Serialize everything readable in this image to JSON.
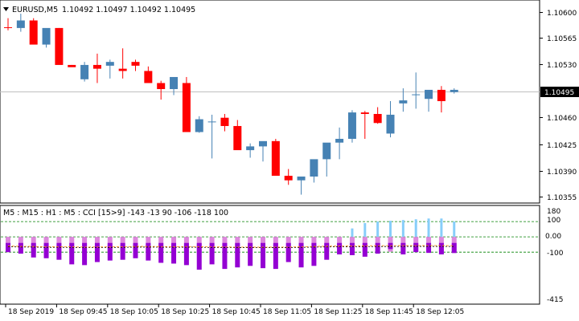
{
  "header": {
    "symbol_timeframe": "EURUSD,M5",
    "ohlc": "1.10492 1.10497 1.10492 1.10495",
    "dropdown_icon": "triangle-down-icon"
  },
  "indicator": {
    "label": "M5 : M15 : H1 : M5 : CCI [15>9] -143 -13 90 -106 -118 100"
  },
  "price_scale": {
    "ticks": [
      "1.10600",
      "1.10565",
      "1.10530",
      "1.10460",
      "1.10425",
      "1.10390",
      "1.10355"
    ],
    "current_price": "1.10495"
  },
  "cci_scale": {
    "ticks": [
      "180",
      "100",
      "0.00",
      "-100",
      "-415"
    ]
  },
  "time_axis": {
    "labels": [
      "18 Sep 2019",
      "18 Sep 09:45",
      "18 Sep 10:05",
      "18 Sep 10:25",
      "18 Sep 10:45",
      "18 Sep 11:05",
      "18 Sep 11:25",
      "18 Sep 11:45",
      "18 Sep 12:05"
    ]
  },
  "colors": {
    "bull": "#4682B4",
    "bear": "#FF0000",
    "hist_light": "#DD88DD",
    "hist_dark": "#9400D3",
    "hist_pos": "#87CEFA",
    "level_line": "#008000",
    "grid_price_line": "#C0C0C0"
  },
  "chart_data": [
    {
      "type": "candlestick",
      "x": [
        "09:25",
        "09:30",
        "09:35",
        "09:40",
        "09:45",
        "09:50",
        "09:55",
        "10:00",
        "10:05",
        "10:10",
        "10:15",
        "10:20",
        "10:25",
        "10:30",
        "10:35",
        "10:40",
        "10:45",
        "10:50",
        "10:55",
        "11:00",
        "11:05",
        "11:10",
        "11:15",
        "11:20",
        "11:25",
        "11:30",
        "11:35",
        "11:40",
        "11:45",
        "11:50",
        "11:55",
        "12:00",
        "12:05",
        "12:10",
        "12:15",
        "12:20"
      ],
      "open": [
        1.10578,
        1.10577,
        1.10587,
        1.10555,
        1.10577,
        1.10528,
        1.10509,
        1.10528,
        1.10527,
        1.10523,
        1.10532,
        1.1052,
        1.10504,
        1.10496,
        1.10504,
        1.10439,
        1.10453,
        1.10458,
        1.10447,
        1.10415,
        1.1042,
        1.10427,
        1.10381,
        1.10375,
        1.1038,
        1.10403,
        1.10425,
        1.1043,
        1.10465,
        1.10463,
        1.10437,
        1.10477,
        1.10489,
        1.10483,
        1.10495,
        1.10492
      ],
      "high": [
        1.1059,
        1.10596,
        1.1059,
        1.10562,
        1.10577,
        1.10528,
        1.10532,
        1.10543,
        1.10535,
        1.1055,
        1.10535,
        1.10526,
        1.10507,
        1.1051,
        1.10512,
        1.1046,
        1.10462,
        1.10463,
        1.10455,
        1.10424,
        1.10426,
        1.1043,
        1.1039,
        1.1038,
        1.104,
        1.10414,
        1.10445,
        1.10468,
        1.10467,
        1.10472,
        1.1048,
        1.10497,
        1.10518,
        1.10485,
        1.105,
        1.10497
      ],
      "low": [
        1.10574,
        1.10572,
        1.10575,
        1.10551,
        1.10537,
        1.10526,
        1.10506,
        1.10504,
        1.1051,
        1.1051,
        1.1052,
        1.10516,
        1.10482,
        1.10488,
        1.1048,
        1.10438,
        1.10404,
        1.1044,
        1.10432,
        1.10405,
        1.104,
        1.10412,
        1.10369,
        1.10356,
        1.10372,
        1.1038,
        1.10403,
        1.10425,
        1.1043,
        1.1045,
        1.10432,
        1.10466,
        1.1047,
        1.10466,
        1.10465,
        1.1049
      ],
      "close": [
        1.10577,
        1.10587,
        1.10555,
        1.10577,
        1.10528,
        1.10525,
        1.10528,
        1.10523,
        1.10532,
        1.1052,
        1.10527,
        1.10504,
        1.10496,
        1.10512,
        1.10439,
        1.10456,
        1.10453,
        1.10447,
        1.10415,
        1.1042,
        1.10427,
        1.10381,
        1.10375,
        1.1038,
        1.10403,
        1.10425,
        1.1043,
        1.10465,
        1.10463,
        1.10451,
        1.10462,
        1.10481,
        1.10489,
        1.10495,
        1.1048,
        1.10495
      ],
      "ylim": [
        1.10347,
        1.10612
      ]
    },
    {
      "type": "bar",
      "ylabel": "",
      "series": [
        {
          "values": [
            -100,
            -103,
            -104,
            -107,
            -106,
            -108,
            -110,
            -109,
            -108,
            -107,
            -104,
            -104,
            -105,
            -106,
            -105,
            -106,
            -108,
            -109,
            -110,
            -110,
            -111,
            -110,
            -110,
            -107,
            -104,
            -102,
            -100,
            -99,
            -98,
            -97,
            -97,
            -96,
            -96,
            -96,
            -96,
            -97
          ]
        },
        {
          "values": [
            -100,
            -110,
            -135,
            -140,
            -150,
            -180,
            -185,
            -165,
            -155,
            -150,
            -140,
            -155,
            -170,
            -175,
            -185,
            -215,
            -180,
            -210,
            -200,
            -190,
            -205,
            -210,
            -165,
            -200,
            -190,
            -150,
            -115,
            -120,
            -130,
            -110,
            -80,
            -115,
            -100,
            -105,
            -115,
            -106
          ]
        },
        {
          "values": [
            0,
            0,
            0,
            0,
            0,
            0,
            0,
            0,
            0,
            0,
            0,
            0,
            0,
            0,
            0,
            0,
            0,
            0,
            0,
            0,
            0,
            0,
            0,
            0,
            0,
            0,
            0,
            55,
            90,
            100,
            105,
            110,
            115,
            120,
            120,
            100
          ]
        }
      ],
      "levels": [
        100,
        0,
        -100
      ],
      "ylim": [
        -430,
        195
      ]
    }
  ]
}
